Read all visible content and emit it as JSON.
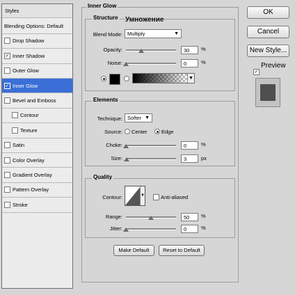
{
  "styles_panel": {
    "header": "Styles",
    "items": [
      {
        "label": "Blending Options: Default",
        "has_checkbox": false,
        "checked": false,
        "selected": false,
        "indent": false
      },
      {
        "label": "Drop Shadow",
        "has_checkbox": true,
        "checked": false,
        "selected": false,
        "indent": false
      },
      {
        "label": "Inner Shadow",
        "has_checkbox": true,
        "checked": true,
        "selected": false,
        "indent": false
      },
      {
        "label": "Outer Glow",
        "has_checkbox": true,
        "checked": false,
        "selected": false,
        "indent": false
      },
      {
        "label": "Inner Glow",
        "has_checkbox": true,
        "checked": true,
        "selected": true,
        "indent": false
      },
      {
        "label": "Bevel and Emboss",
        "has_checkbox": true,
        "checked": false,
        "selected": false,
        "indent": false
      },
      {
        "label": "Contour",
        "has_checkbox": true,
        "checked": false,
        "selected": false,
        "indent": true
      },
      {
        "label": "Texture",
        "has_checkbox": true,
        "checked": false,
        "selected": false,
        "indent": true
      },
      {
        "label": "Satin",
        "has_checkbox": true,
        "checked": false,
        "selected": false,
        "indent": false
      },
      {
        "label": "Color Overlay",
        "has_checkbox": true,
        "checked": false,
        "selected": false,
        "indent": false
      },
      {
        "label": "Gradient Overlay",
        "has_checkbox": true,
        "checked": false,
        "selected": false,
        "indent": false
      },
      {
        "label": "Pattern Overlay",
        "has_checkbox": true,
        "checked": false,
        "selected": false,
        "indent": false
      },
      {
        "label": "Stroke",
        "has_checkbox": true,
        "checked": false,
        "selected": false,
        "indent": false
      }
    ]
  },
  "inner_glow": {
    "title": "Inner Glow",
    "structure": {
      "title": "Structure",
      "annotation": "Умножение",
      "blend_mode_label": "Blend Mode:",
      "blend_mode_value": "Multiply",
      "opacity_label": "Opacity:",
      "opacity_value": "30",
      "opacity_level": 0.3,
      "noise_label": "Noise:",
      "noise_value": "0",
      "noise_level": 0,
      "percent": "%"
    },
    "elements": {
      "title": "Elements",
      "technique_label": "Technique:",
      "technique_value": "Softer",
      "source_label": "Source:",
      "source_center": "Center",
      "source_edge": "Edge",
      "choke_label": "Choke:",
      "choke_value": "0",
      "choke_level": 0,
      "size_label": "Size:",
      "size_value": "3",
      "size_level": 0.012,
      "percent": "%",
      "px": "px"
    },
    "quality": {
      "title": "Quality",
      "contour_label": "Contour:",
      "anti_aliased_label": "Anti-aliased",
      "range_label": "Range:",
      "range_value": "50",
      "range_level": 0.5,
      "jitter_label": "Jitter:",
      "jitter_value": "0",
      "jitter_level": 0,
      "percent": "%"
    },
    "make_default": "Make Default",
    "reset_to_default": "Reset to Default"
  },
  "right_buttons": {
    "ok": "OK",
    "cancel": "Cancel",
    "new_style": "New Style...",
    "preview_label": "Preview"
  },
  "colors": {
    "selection": "#3a6fd8",
    "glow_swatch": "#000000",
    "preview_swatch": "#4f4f4f"
  }
}
